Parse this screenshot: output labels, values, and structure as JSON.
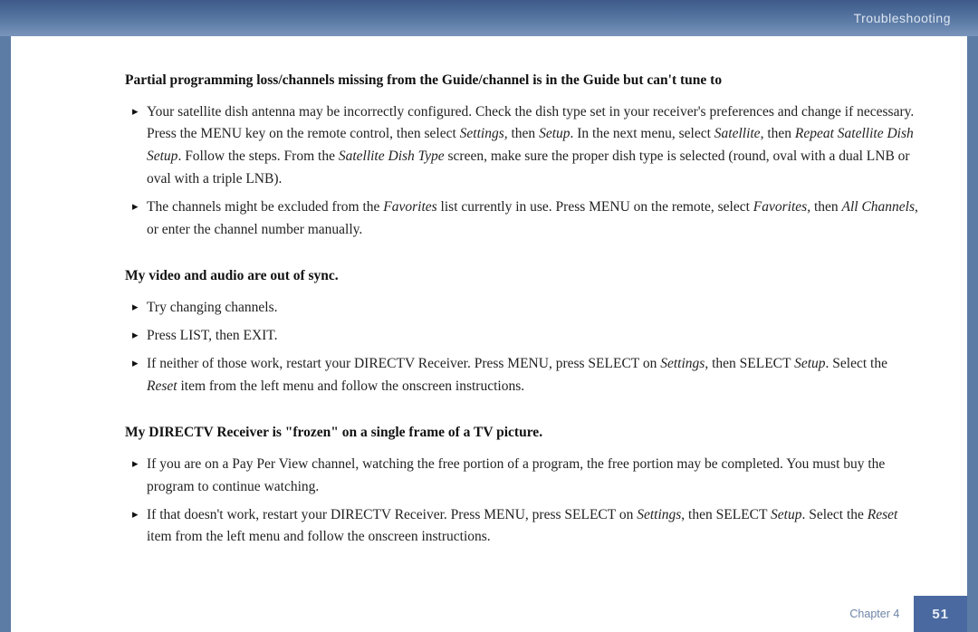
{
  "header": {
    "breadcrumb": "Troubleshooting"
  },
  "sections": [
    {
      "heading": "Partial programming loss/channels missing from the Guide/channel is in the Guide but can't tune to",
      "items": [
        {
          "html": "Your satellite dish antenna may be incorrectly configured. Check the dish type set in your receiver's preferences and change if necessary. Press the MENU key on the remote control, then select <span class=\"italic\">Settings,</span> then <span class=\"italic\">Setup</span>. In the next menu, select <span class=\"italic\">Satellite</span>, then <span class=\"italic\">Repeat Satellite Dish Setup</span>. Follow the steps. From the <span class=\"italic\">Satellite Dish Type</span> screen, make sure the proper dish type is selected (round, oval with a dual LNB or oval with a triple LNB)."
        },
        {
          "html": "The channels might be excluded from the <span class=\"italic\">Favorites</span> list currently in use. Press MENU on the remote, select <span class=\"italic\">Favorites</span>, then <span class=\"italic\">All Channels</span>, or enter the channel number manually."
        }
      ]
    },
    {
      "heading": "My video and audio are out of sync.",
      "items": [
        {
          "html": "Try changing channels."
        },
        {
          "html": "Press LIST, then EXIT."
        },
        {
          "html": "If neither of those work, restart your DIRECTV Receiver. Press MENU, press SELECT on <span class=\"italic\">Settings</span>, then SELECT <span class=\"italic\">Setup</span>. Select the <span class=\"italic\">Reset</span> item from the left menu and follow the onscreen instructions."
        }
      ]
    },
    {
      "heading": "My DIRECTV Receiver is \"frozen\" on a single frame of a TV picture.",
      "items": [
        {
          "html": "If you are on a Pay Per View channel, watching the free portion of a program, the free portion may be completed. You must buy the program to continue watching."
        },
        {
          "html": "If that doesn't work, restart your DIRECTV Receiver. Press MENU, press SELECT on <span class=\"italic\">Settings</span>, then SELECT <span class=\"italic\">Setup</span>. Select the <span class=\"italic\">Reset</span> item from the left menu and follow the onscreen instructions."
        }
      ]
    }
  ],
  "footer": {
    "chapter": "Chapter 4",
    "page_number": "51"
  }
}
